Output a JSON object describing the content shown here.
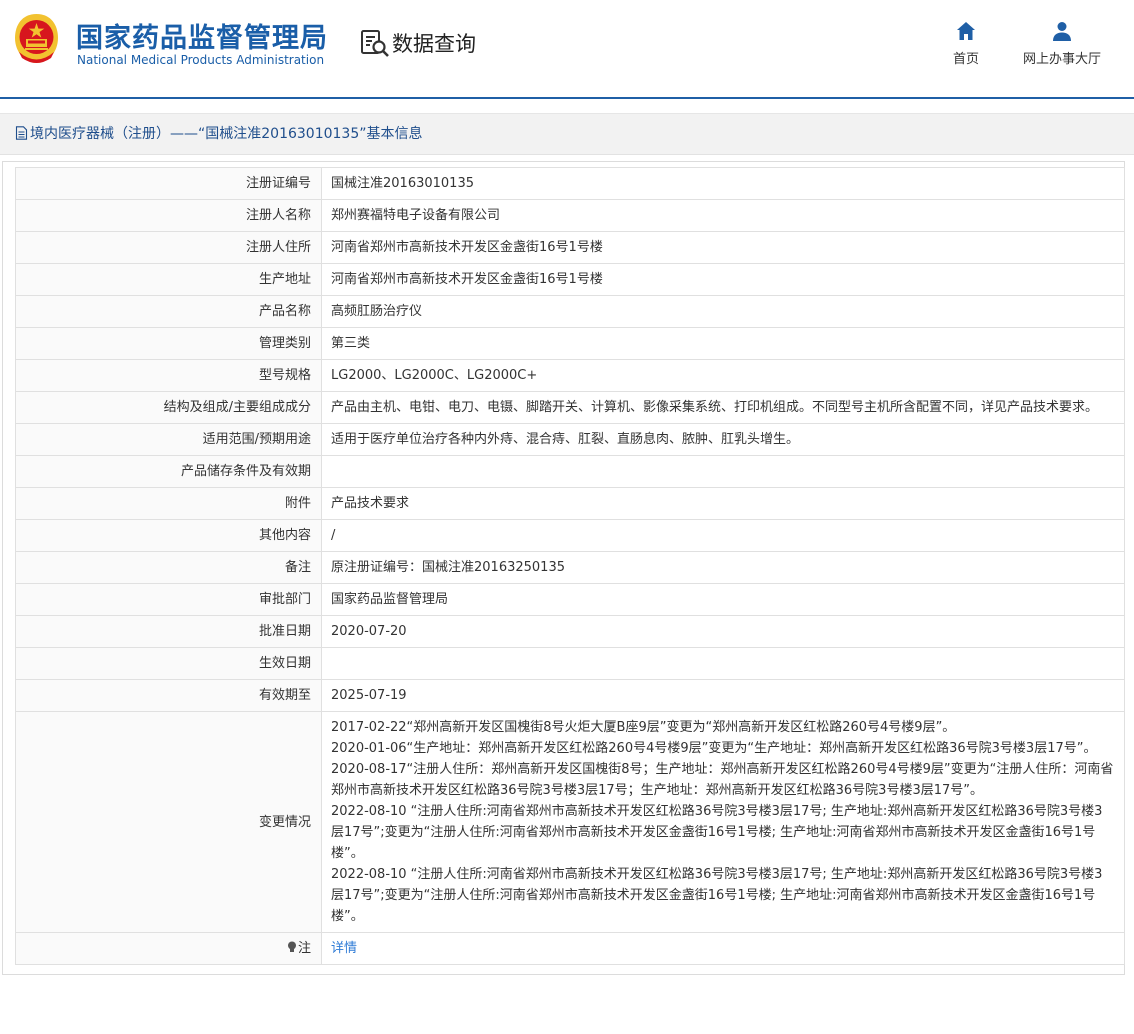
{
  "header": {
    "org_name_cn": "国家药品监督管理局",
    "org_name_en": "National Medical Products Administration",
    "section_title": "数据查询",
    "nav": [
      {
        "label": "首页",
        "icon": "home-icon"
      },
      {
        "label": "网上办事大厅",
        "icon": "user-icon"
      }
    ]
  },
  "panel": {
    "title": "境内医疗器械（注册）——“国械注准20163010135”基本信息"
  },
  "rows": [
    {
      "label": "注册证编号",
      "value": "国械注准20163010135"
    },
    {
      "label": "注册人名称",
      "value": "郑州赛福特电子设备有限公司"
    },
    {
      "label": "注册人住所",
      "value": "河南省郑州市高新技术开发区金盏街16号1号楼"
    },
    {
      "label": "生产地址",
      "value": "河南省郑州市高新技术开发区金盏街16号1号楼"
    },
    {
      "label": "产品名称",
      "value": "高频肛肠治疗仪"
    },
    {
      "label": "管理类别",
      "value": "第三类"
    },
    {
      "label": "型号规格",
      "value": "LG2000、LG2000C、LG2000C+"
    },
    {
      "label": "结构及组成/主要组成成分",
      "value": "产品由主机、电钳、电刀、电镊、脚踏开关、计算机、影像采集系统、打印机组成。不同型号主机所含配置不同，详见产品技术要求。"
    },
    {
      "label": "适用范围/预期用途",
      "value": "适用于医疗单位治疗各种内外痔、混合痔、肛裂、直肠息肉、脓肿、肛乳头增生。"
    },
    {
      "label": "产品储存条件及有效期",
      "value": ""
    },
    {
      "label": "附件",
      "value": "产品技术要求"
    },
    {
      "label": "其他内容",
      "value": "/"
    },
    {
      "label": "备注",
      "value": "原注册证编号：国械注准20163250135"
    },
    {
      "label": "审批部门",
      "value": "国家药品监督管理局"
    },
    {
      "label": "批准日期",
      "value": "2020-07-20"
    },
    {
      "label": "生效日期",
      "value": ""
    },
    {
      "label": "有效期至",
      "value": "2025-07-19"
    }
  ],
  "changes": {
    "label": "变更情况",
    "entries": [
      "2017-02-22“郑州高新开发区国槐街8号火炬大厦B座9层”变更为“郑州高新开发区红松路260号4号楼9层”。",
      "2020-01-06“生产地址：郑州高新开发区红松路260号4号楼9层”变更为“生产地址：郑州高新开发区红松路36号院3号楼3层17号”。",
      "2020-08-17“注册人住所：郑州高新开发区国槐街8号；生产地址：郑州高新开发区红松路260号4号楼9层”变更为“注册人住所：河南省郑州市高新技术开发区红松路36号院3号楼3层17号；生产地址：郑州高新开发区红松路36号院3号楼3层17号”。",
      "2022-08-10 “注册人住所:河南省郑州市高新技术开发区红松路36号院3号楼3层17号; 生产地址:郑州高新开发区红松路36号院3号楼3层17号”;变更为“注册人住所:河南省郑州市高新技术开发区金盏街16号1号楼; 生产地址:河南省郑州市高新技术开发区金盏街16号1号楼”。",
      "2022-08-10 “注册人住所:河南省郑州市高新技术开发区红松路36号院3号楼3层17号; 生产地址:郑州高新开发区红松路36号院3号楼3层17号”;变更为“注册人住所:河南省郑州市高新技术开发区金盏街16号1号楼; 生产地址:河南省郑州市高新技术开发区金盏街16号1号楼”。"
    ]
  },
  "note": {
    "label": "注",
    "link_text": "详情",
    "icon": "lightbulb-icon"
  },
  "colors": {
    "brand_blue": "#1a5ea8",
    "link_blue": "#2e7bd6",
    "header_rule": "#1f5fa6",
    "emblem_red": "#d7161e",
    "emblem_gold": "#f2c230"
  }
}
